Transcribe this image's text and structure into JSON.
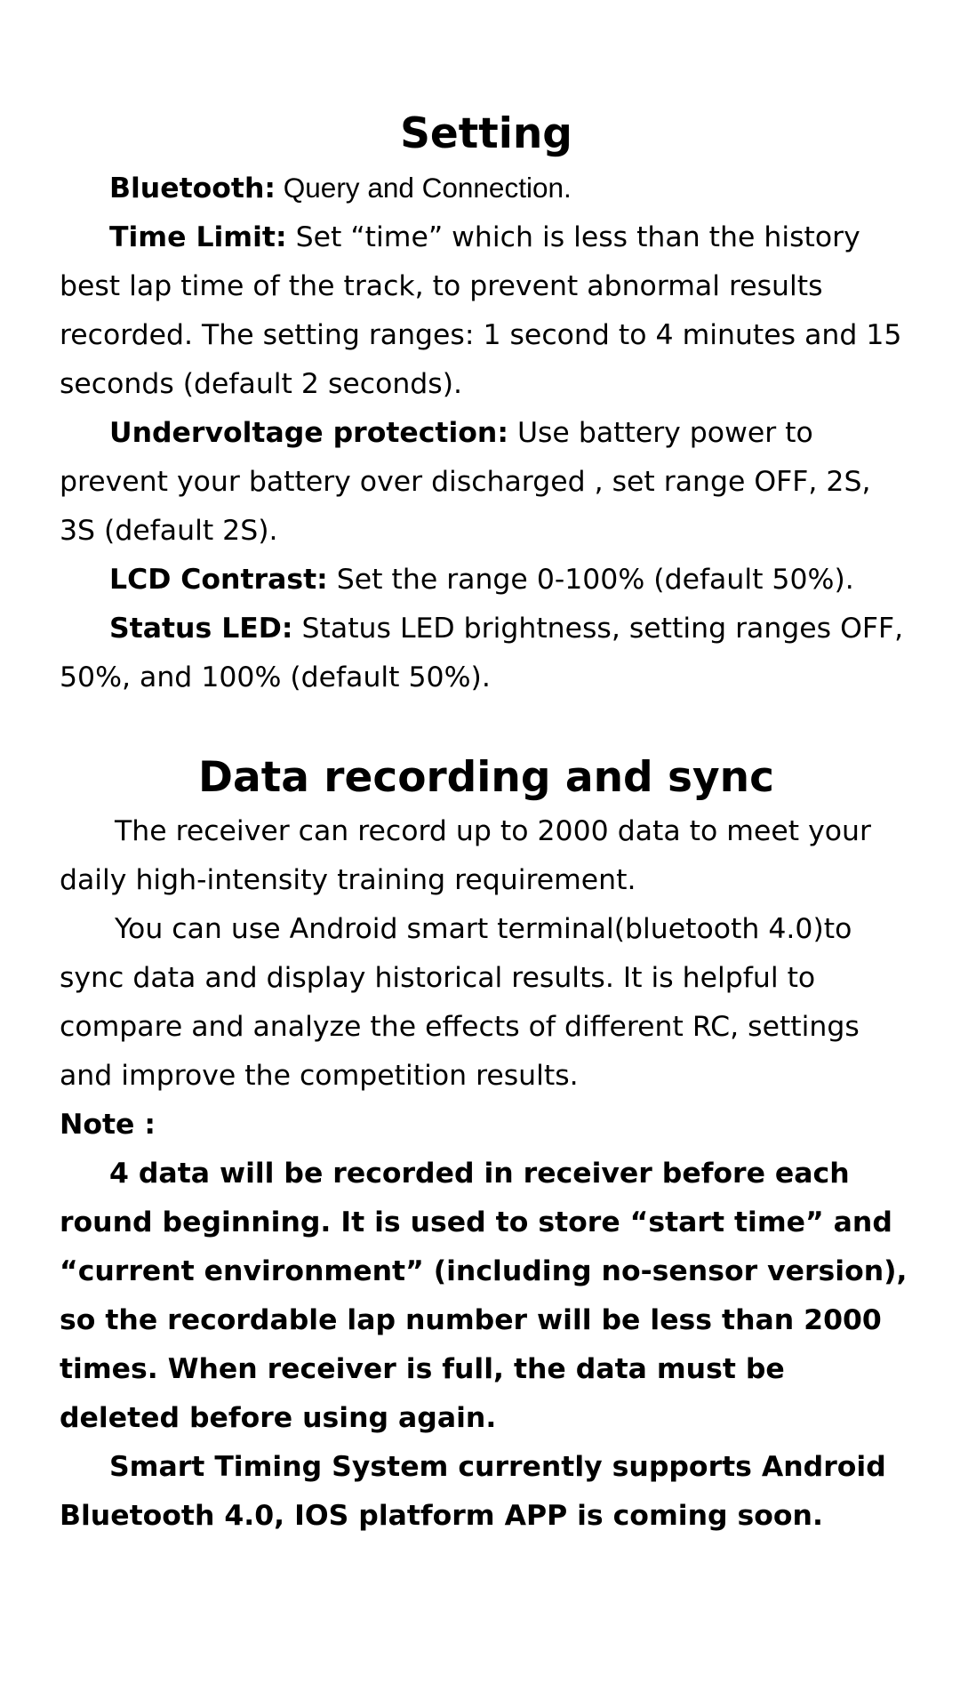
{
  "setting": {
    "title": "Setting",
    "bluetooth": {
      "term": "Bluetooth:",
      "text": " Query and Connection."
    },
    "time_limit": {
      "term": "Time Limit:",
      "text": " Set “time” which is less than the history best lap time of the track, to prevent abnormal results recorded. The setting ranges: 1 second to 4 minutes and 15 seconds (default 2 seconds)."
    },
    "undervoltage": {
      "term": "Undervoltage protection:",
      "text": " Use battery power to prevent your battery over discharged , set range OFF, 2S, 3S (default 2S)."
    },
    "lcd_contrast": {
      "term": "LCD Contrast:",
      "text": " Set the range 0-100% (default 50%)."
    },
    "status_led": {
      "term": "Status LED:",
      "text": " Status LED brightness, setting ranges OFF, 50%, and 100% (default 50%)."
    }
  },
  "data_recording": {
    "title": "Data recording and sync",
    "para1": "The receiver can record up to 2000 data to meet your daily high-intensity training requirement.",
    "para2": "You can use Android smart terminal(bluetooth 4.0)to sync data and display historical results. It is helpful to compare and analyze the effects of different RC, settings and improve the competition results.",
    "note_label": "Note :",
    "note1": "4 data will be recorded in receiver before each round beginning. It is used to store “start time” and “current environment” (including no-sensor version), so the recordable lap number will be less than 2000 times. When receiver is full, the data must be deleted before using again.",
    "note2": "Smart Timing System currently supports Android Bluetooth 4.0, IOS platform APP is coming soon."
  }
}
